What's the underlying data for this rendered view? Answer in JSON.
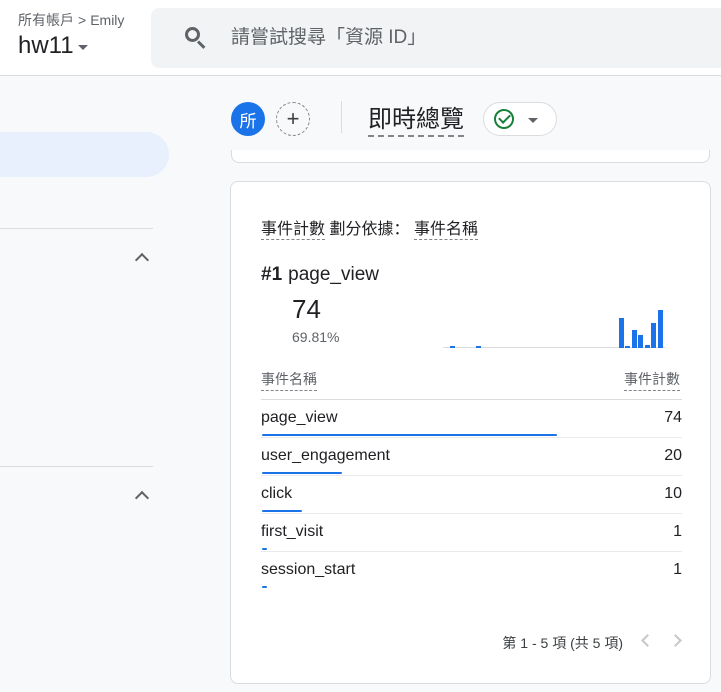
{
  "header": {
    "breadcrumb": [
      "所有帳戶",
      "Emily"
    ],
    "breadcrumb_sep": ">",
    "property": "hw11"
  },
  "search": {
    "placeholder": "請嘗試搜尋「資源 ID」"
  },
  "toolbar": {
    "user_chip": "所",
    "add_chip": "+",
    "title": "即時總覽",
    "status": "check"
  },
  "card": {
    "title_metric": "事件計數",
    "title_mid": "劃分依據：",
    "title_dimension": "事件名稱",
    "top_rank": "#1",
    "top_name": "page_view",
    "top_value": "74",
    "top_percent": "69.81%",
    "sparkline": [
      0,
      1,
      0,
      0,
      0,
      1,
      0,
      0,
      0,
      0,
      0,
      0,
      0,
      0,
      0,
      0,
      0,
      0,
      0,
      0,
      0,
      0,
      0,
      0,
      0,
      0,
      0,
      28,
      2,
      17,
      12,
      3,
      24,
      36
    ],
    "col_name": "事件名稱",
    "col_value": "事件計數",
    "rows": [
      {
        "name": "page_view",
        "value": "74",
        "share": 0.7
      },
      {
        "name": "user_engagement",
        "value": "20",
        "share": 0.19
      },
      {
        "name": "click",
        "value": "10",
        "share": 0.095
      },
      {
        "name": "first_visit",
        "value": "1",
        "share": 0.012
      },
      {
        "name": "session_start",
        "value": "1",
        "share": 0.012
      }
    ],
    "pagination": "第 1 - 5 項 (共 5 項)"
  },
  "colors": {
    "accent": "#1a73e8",
    "success": "#188038",
    "nav_active": "#e8f0fe"
  }
}
